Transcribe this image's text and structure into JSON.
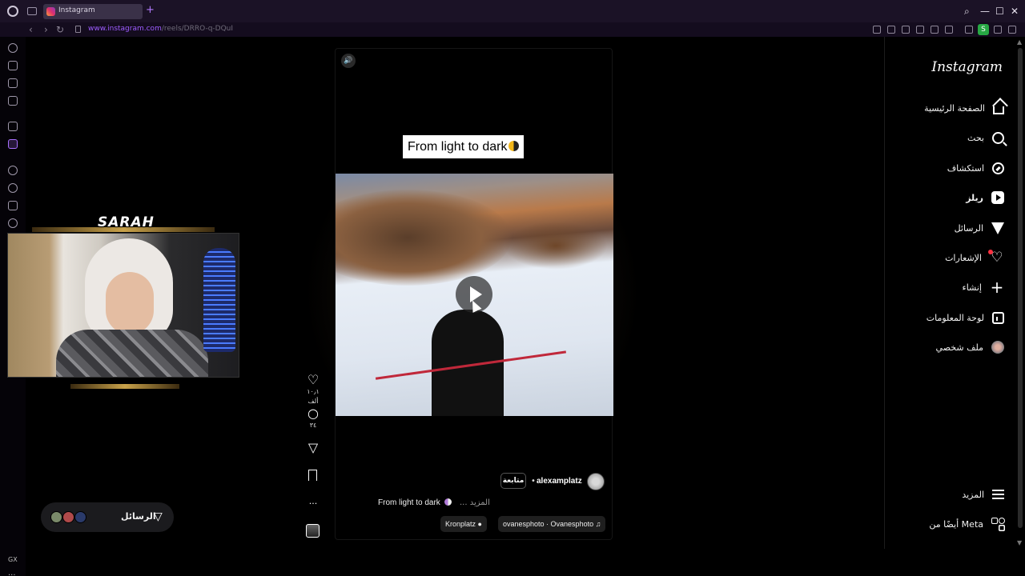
{
  "browser": {
    "tab_title": "Instagram",
    "new_tab_glyph": "+",
    "url_host": "www.instagram.com",
    "url_path": "/reels/DRRO-q-DQuI",
    "extension_badge": "S",
    "window_controls": [
      "⌕",
      "—",
      "☐",
      "✕"
    ],
    "nav_glyphs": [
      "‹",
      "›",
      "↻"
    ]
  },
  "gx_sidebar": {
    "label": "GX",
    "more": "···"
  },
  "webcam": {
    "brand": "SARAH"
  },
  "messages_pill": {
    "label": "الرسائل"
  },
  "reel": {
    "overlay_title": "From light to dark",
    "author": "alexamplatz",
    "separator": "•",
    "follow_label": "متابعة",
    "caption": "From light to dark",
    "more_label": "... المزيد",
    "location": "Kronplatz",
    "audio": "ovanesphoto · Ovanesphoto",
    "likes": "١٠٫١ ألف",
    "comments": "٣٤",
    "more_options": "···"
  },
  "nav": {
    "logo": "Instagram",
    "items": [
      {
        "label": "الصفحة الرئيسية",
        "icon": "home-icon"
      },
      {
        "label": "بحث",
        "icon": "search-icon"
      },
      {
        "label": "استكشاف",
        "icon": "compass-icon"
      },
      {
        "label": "ريلز",
        "icon": "reels-icon"
      },
      {
        "label": "الرسائل",
        "icon": "send-icon"
      },
      {
        "label": "الإشعارات",
        "icon": "heart-icon"
      },
      {
        "label": "إنشاء",
        "icon": "plus-icon"
      },
      {
        "label": "لوحة المعلومات",
        "icon": "chart-icon"
      },
      {
        "label": "ملف شخصي",
        "icon": "avatar-icon"
      }
    ],
    "more": "المزيد",
    "also_from_meta": "أيضًا من Meta"
  },
  "colors": {
    "accent": "#9d5cff",
    "notification": "#ff3040",
    "extension_green": "#27a844"
  }
}
